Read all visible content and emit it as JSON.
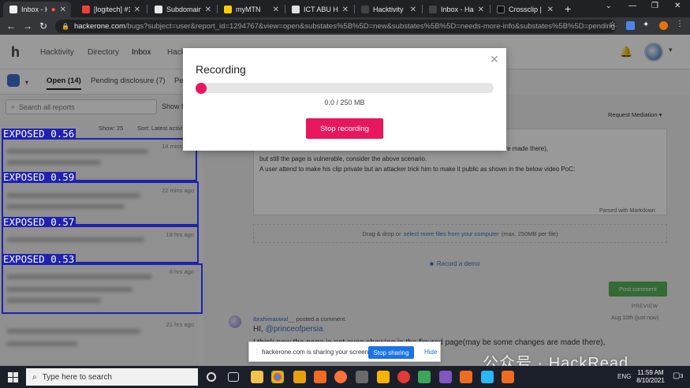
{
  "browser": {
    "tabs": [
      {
        "label": "Inbox - H",
        "color": "#f0f0f0"
      },
      {
        "label": "[logitech] #12",
        "color": "#ea4335"
      },
      {
        "label": "Subdomain F",
        "color": "#e8e8e8"
      },
      {
        "label": "myMTN",
        "color": "#ffcc00"
      },
      {
        "label": "ICT ABU HOT",
        "color": "#e0e0e0"
      },
      {
        "label": "Hacktivity",
        "color": "#444444"
      },
      {
        "label": "Inbox - Hack",
        "color": "#444444"
      },
      {
        "label": "Crossclip | Th",
        "color": "#111111"
      }
    ],
    "url_host": "hackerone.com",
    "url_rest": "/bugs?subject=user&report_id=1294767&view=open&substates%5B%5D=new&substates%5B%5D=needs-more-info&substates%5B%5D=pending-pr..."
  },
  "site": {
    "nav": [
      "Hacktivity",
      "Directory",
      "Inbox",
      "Hack"
    ],
    "subtabs": [
      "Open",
      "(14)",
      "Pending disclosure",
      "(7)",
      "Pe"
    ],
    "search_placeholder": "Search all reports",
    "show_label": "Show fi",
    "show_count": "Show: 25",
    "sort_label": "Sort: Latest activi"
  },
  "reports": [
    {
      "time": "14 mins ago"
    },
    {
      "time": "22 mins ago"
    },
    {
      "time": "18 hrs ago"
    },
    {
      "time": "6 hrs ago"
    },
    {
      "time": "21 hrs ago"
    }
  ],
  "detections": [
    {
      "label": "EXPOSED 0.56"
    },
    {
      "label": "EXPOSED 0.59"
    },
    {
      "label": "EXPOSED 0.57"
    },
    {
      "label": "EXPOSED 0.53"
    }
  ],
  "editor": {
    "request_mediation": "Request Mediation",
    "line1": "are made there),",
    "line2": "but still the page is vulnerable, consider the above scenario.",
    "line3": "A user attend to make his clip private but an attacker trick him to make it public as shown in the below video PoC:",
    "parsed": "Parsed with Markdown",
    "drop_text": "Drag & drop or",
    "drop_link": "select more files from your computer",
    "drop_max": "(max. 250MB per file)",
    "record_demo": "Record a demo",
    "post_comment": "Post comment",
    "preview": "PREVIEW"
  },
  "comment": {
    "author": "ibrahimauwal__",
    "action": "posted a comment.",
    "date": "Aug 10th (just now)",
    "greeting": "HI,",
    "mention": "@princeofpersia",
    "body": "I think now the page is not even showing in the figured page(may be some changes are made there),"
  },
  "modal": {
    "title": "Recording",
    "size": "0.0 / 250 MB",
    "stop_label": "Stop recording"
  },
  "share": {
    "text": "hackerone.com is sharing your screen.",
    "stop": "Stop sharing",
    "hide": "Hide"
  },
  "watermark": "公众号 · HackRead",
  "taskbar": {
    "search_placeholder": "Type here to search",
    "lang": "ENG",
    "time": "11:59 AM",
    "date": "8/10/2021",
    "notif_count": "3"
  }
}
